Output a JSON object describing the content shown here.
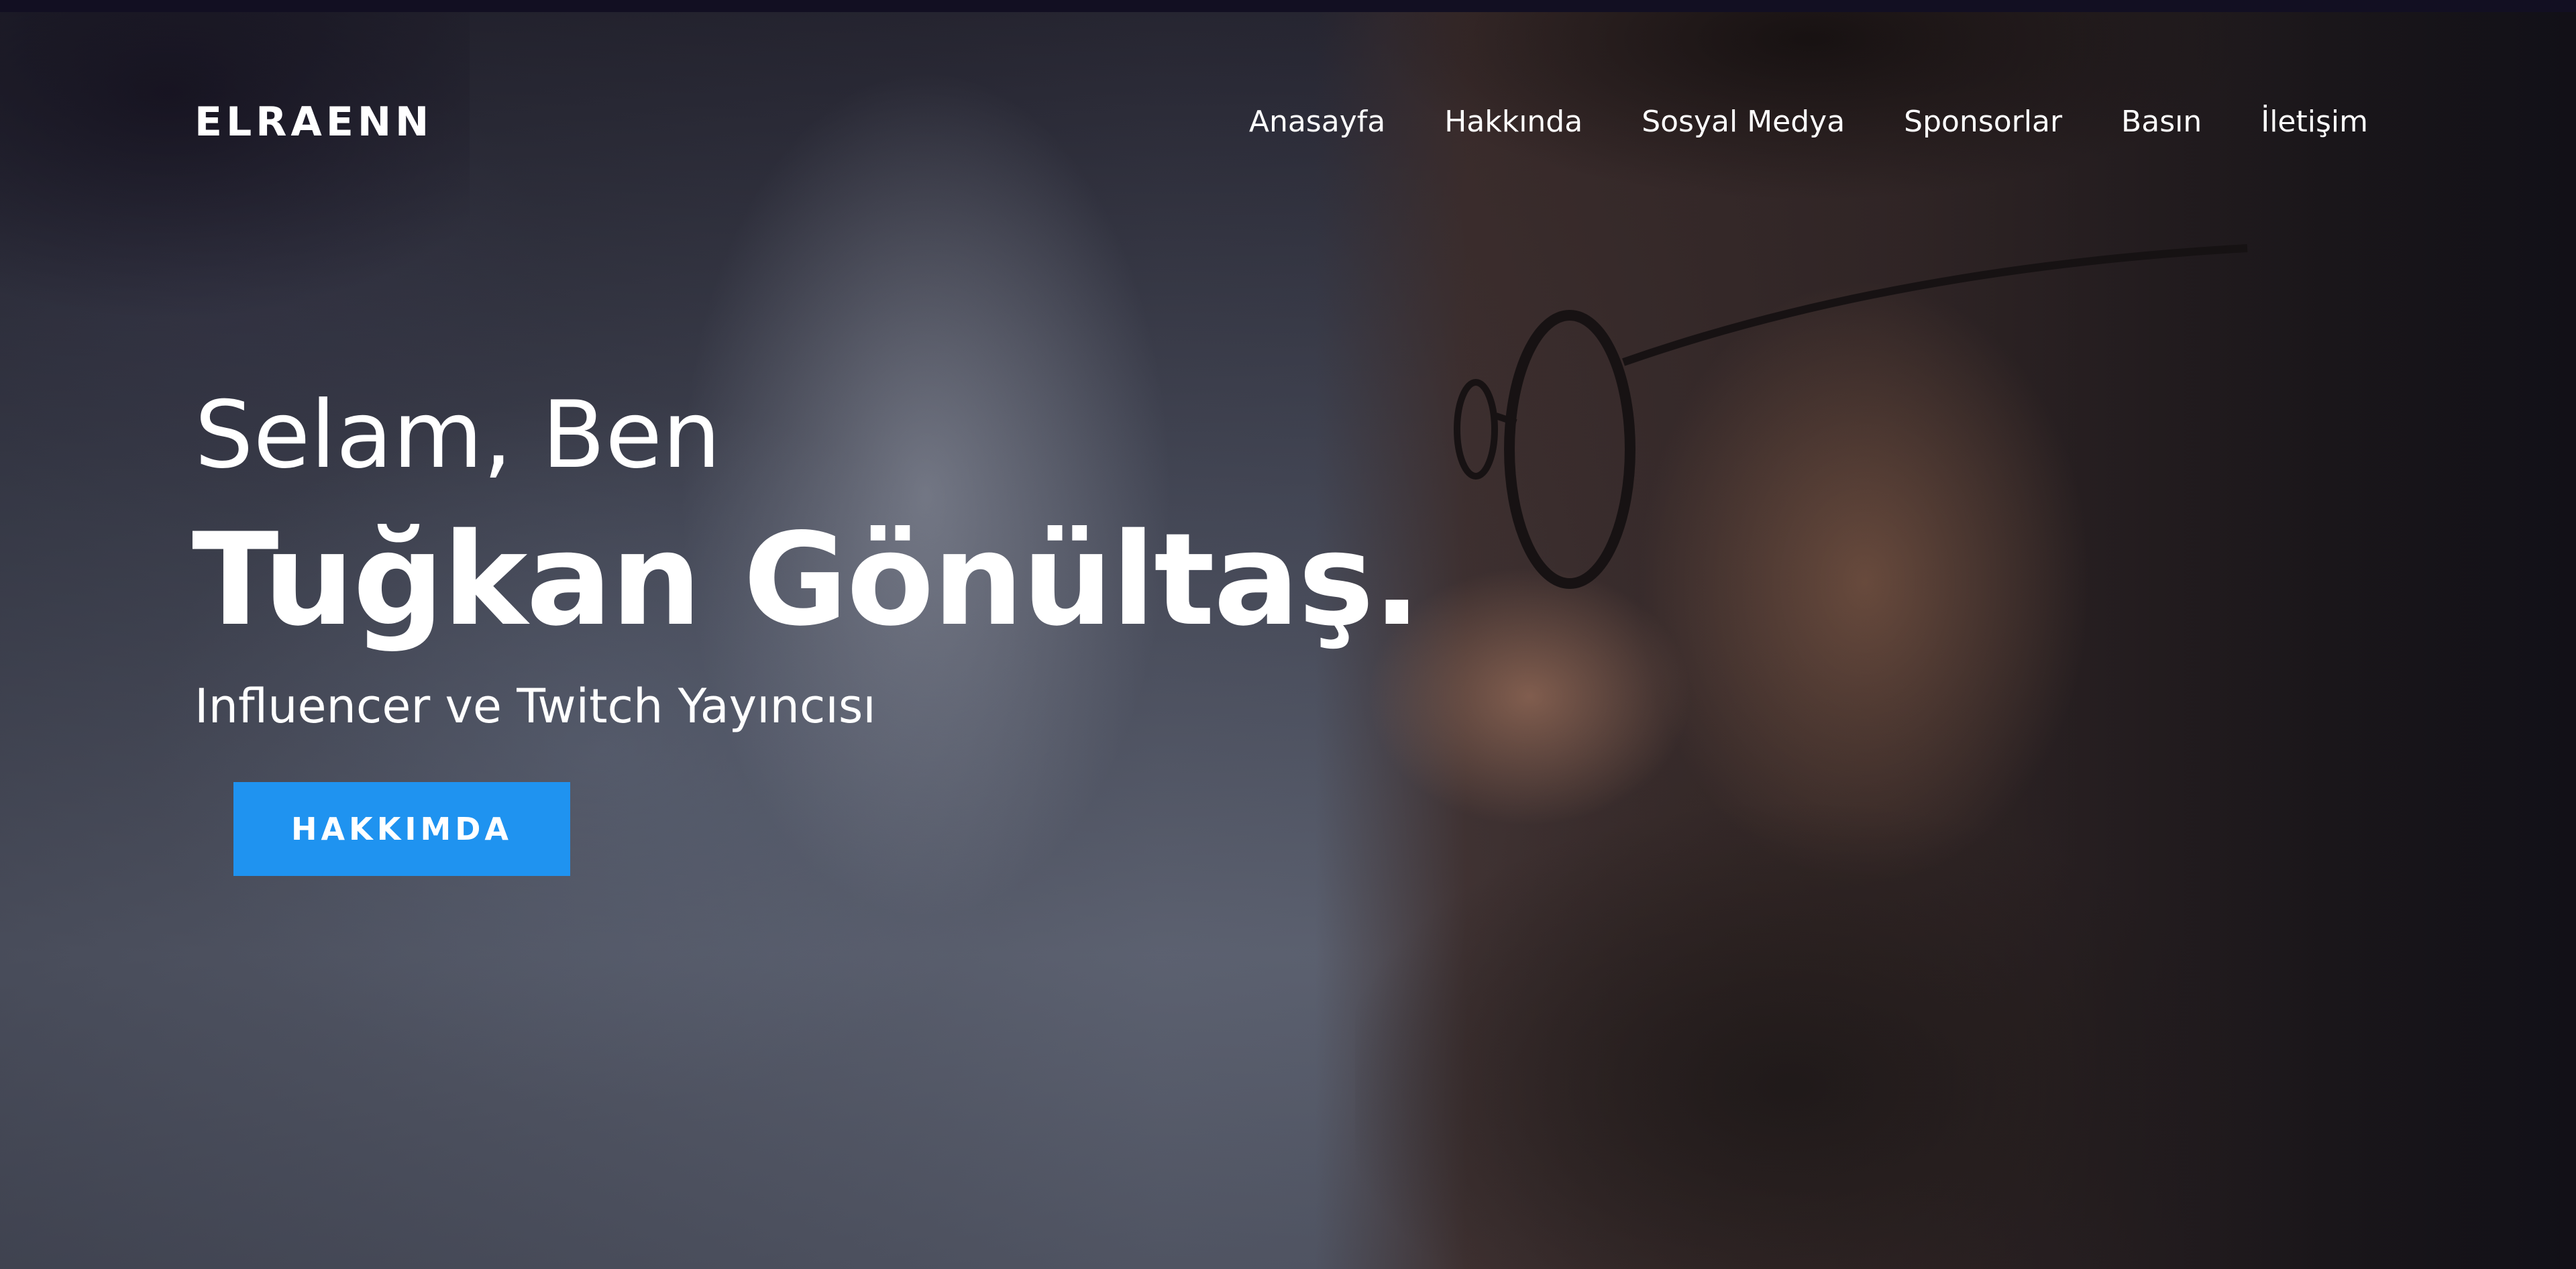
{
  "brand": {
    "name": "ELRAENN"
  },
  "nav": {
    "items": [
      {
        "label": "Anasayfa"
      },
      {
        "label": "Hakkında"
      },
      {
        "label": "Sosyal Medya"
      },
      {
        "label": "Sponsorlar"
      },
      {
        "label": "Basın"
      },
      {
        "label": "İletişim"
      }
    ]
  },
  "hero": {
    "greeting": "Selam, Ben",
    "name": "Tuğkan Gönültaş.",
    "subtitle": "Influencer ve Twitch Yayıncısı",
    "cta_label": "HAKKIMDA"
  },
  "colors": {
    "accent": "#1f93f0",
    "top_strip": "#120f22",
    "text": "#ffffff"
  }
}
